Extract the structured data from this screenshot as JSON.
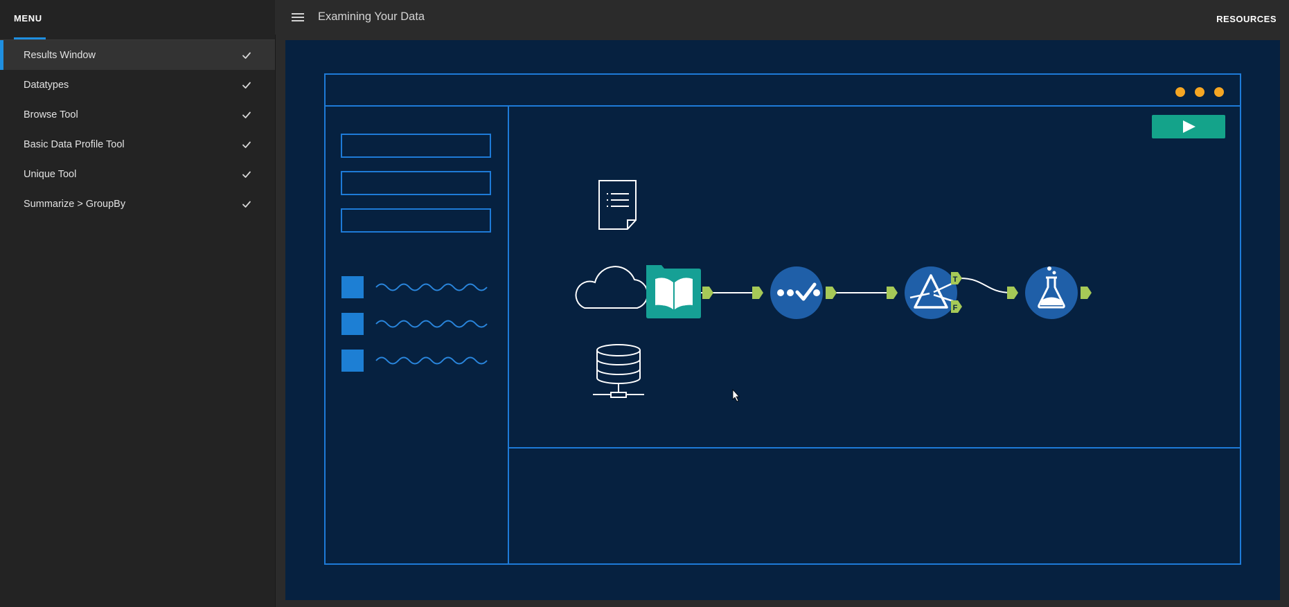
{
  "sidebar": {
    "title": "MENU",
    "items": [
      {
        "label": "Results Window",
        "active": true
      },
      {
        "label": "Datatypes"
      },
      {
        "label": "Browse Tool"
      },
      {
        "label": "Basic Data Profile Tool"
      },
      {
        "label": "Unique Tool"
      },
      {
        "label": "Summarize > GroupBy"
      }
    ]
  },
  "header": {
    "title": "Examining Your Data",
    "resources_label": "RESOURCES"
  },
  "illustration": {
    "true_anchor": "T",
    "false_anchor": "F"
  },
  "colors": {
    "accent_blue": "#1f8fe0",
    "stage_bg": "#062140",
    "frame_line": "#1e7bd8",
    "window_dot": "#f5a623",
    "run_button": "#14a38a",
    "node_blue": "#1f5fa8",
    "node_teal": "#16a095",
    "connector_green": "#a6c957"
  }
}
